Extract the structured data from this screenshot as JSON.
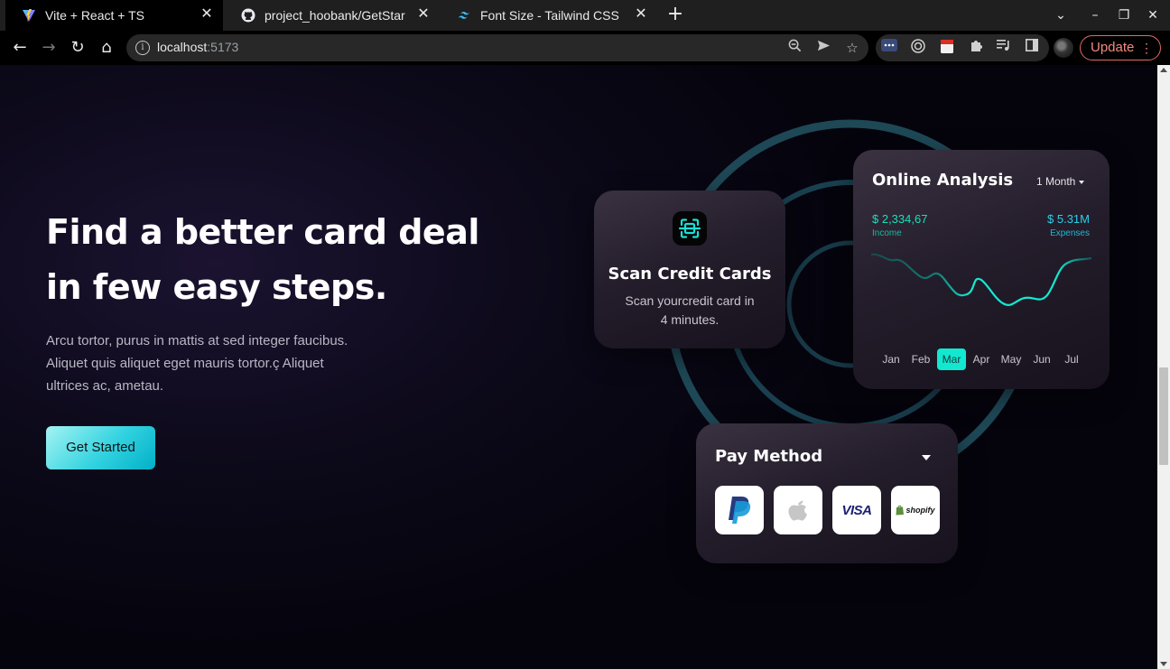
{
  "browser": {
    "tabs": [
      {
        "title": "Vite + React + TS",
        "active": true,
        "icon": "vite-icon"
      },
      {
        "title": "project_hoobank/GetStar",
        "active": false,
        "icon": "github-icon"
      },
      {
        "title": "Font Size - Tailwind CSS",
        "active": false,
        "icon": "tailwind-icon"
      }
    ],
    "url_host": "localhost",
    "url_port": ":5173",
    "update_label": "Update"
  },
  "hero": {
    "title_line1": "Find a better card deal",
    "title_line2": "in few easy steps.",
    "description_line1": "Arcu tortor, purus in mattis at sed integer faucibus.",
    "description_line2": "Aliquet quis aliquet eget mauris tortor.ç Aliquet",
    "description_line3": "ultrices ac, ametau.",
    "cta_label": "Get Started"
  },
  "scan_card": {
    "title": "Scan Credit Cards",
    "description_line1": "Scan yourcredit card in",
    "description_line2": "4 minutes."
  },
  "analysis_card": {
    "title": "Online Analysis",
    "period": "1 Month",
    "income_value": "$ 2,334,67",
    "income_label": "Income",
    "expenses_value": "$ 5.31M",
    "expenses_label": "Expenses",
    "months": [
      "Jan",
      "Feb",
      "Mar",
      "Apr",
      "May",
      "Jun",
      "Jul"
    ],
    "active_month": "Mar"
  },
  "pay_card": {
    "title": "Pay Method",
    "methods": [
      "paypal-logo",
      "apple-logo",
      "visa-logo",
      "shopify-logo"
    ],
    "visa_text": "VISA",
    "shopify_text": "shopify"
  },
  "colors": {
    "accent": "#12e8d0",
    "income": "#18e0b8",
    "expenses": "#2bd0ea",
    "ring": "#1f4b58"
  }
}
